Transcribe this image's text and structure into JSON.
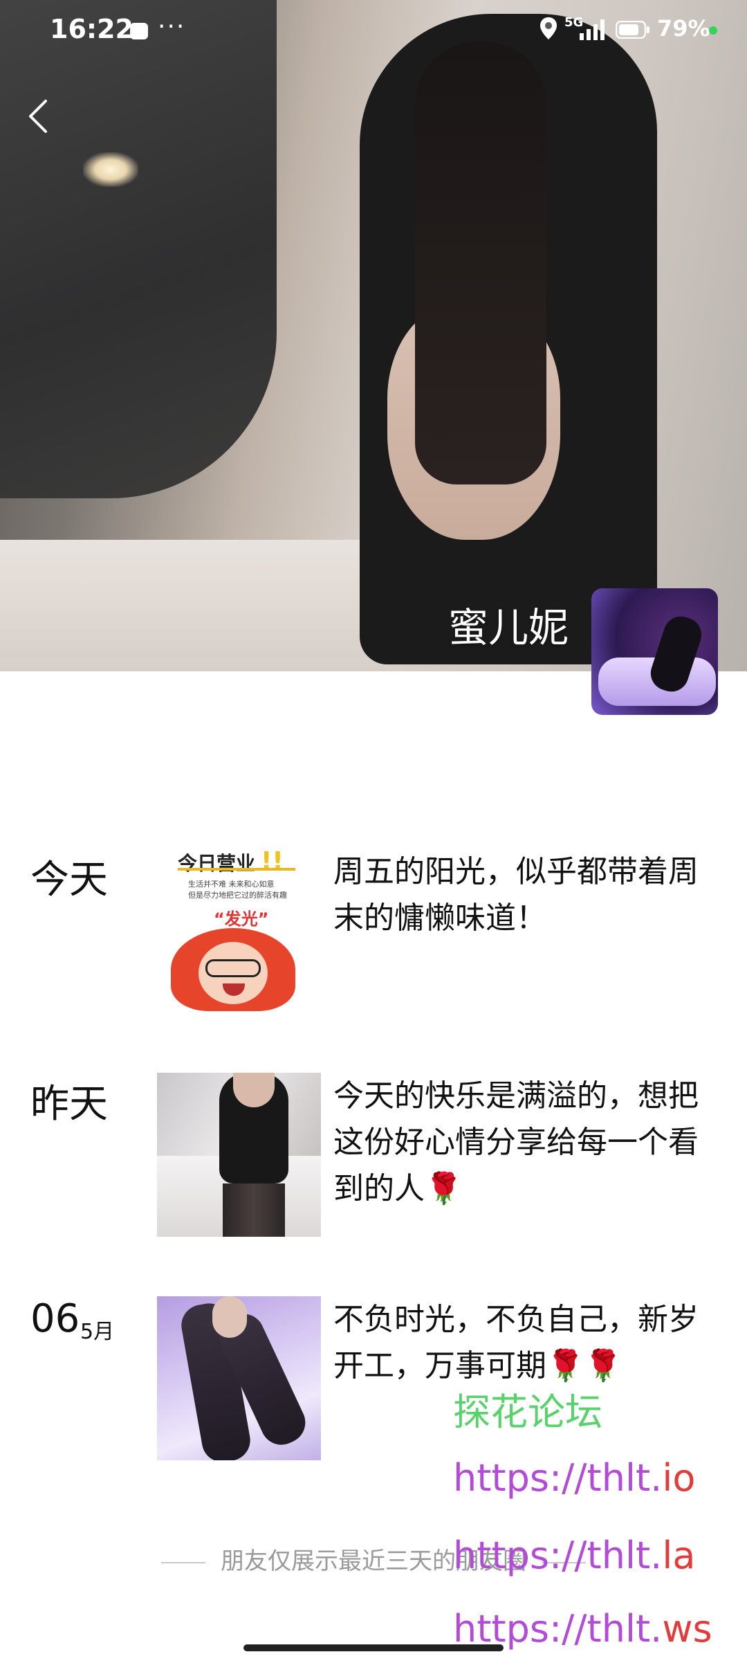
{
  "status_bar": {
    "time": "16:22",
    "more": "···",
    "network": "5G",
    "battery": "79%",
    "dot_color": "#36d35c"
  },
  "profile": {
    "name": "蜜儿妮"
  },
  "moments": [
    {
      "date": "今天",
      "text": "周五的阳光，似乎都带着周末的慵懒味道！",
      "thumb_text": {
        "head": "今日营业",
        "small_1": "生活并不难 未来和心如意",
        "small_2": "但是尽力地把它过的醉活有趣",
        "glow": "“发光”"
      }
    },
    {
      "date": "昨天",
      "text": "今天的快乐是满溢的，想把这份好心情分享给每一个看到的人🌹"
    },
    {
      "day": "06",
      "month": "5月",
      "text": "不负时光，不负自己，新岁开工，万事可期🌹🌹"
    }
  ],
  "footer": {
    "note": "朋友仅展示最近三天的朋友圈"
  },
  "watermark": {
    "title": "探花论坛",
    "link_1_prefix": "https://thlt.",
    "link_1_suffix": "io",
    "link_2_prefix": "https://thlt.",
    "link_2_suffix": "la",
    "link_3_prefix": "https://thlt.",
    "link_3_suffix": "ws"
  }
}
